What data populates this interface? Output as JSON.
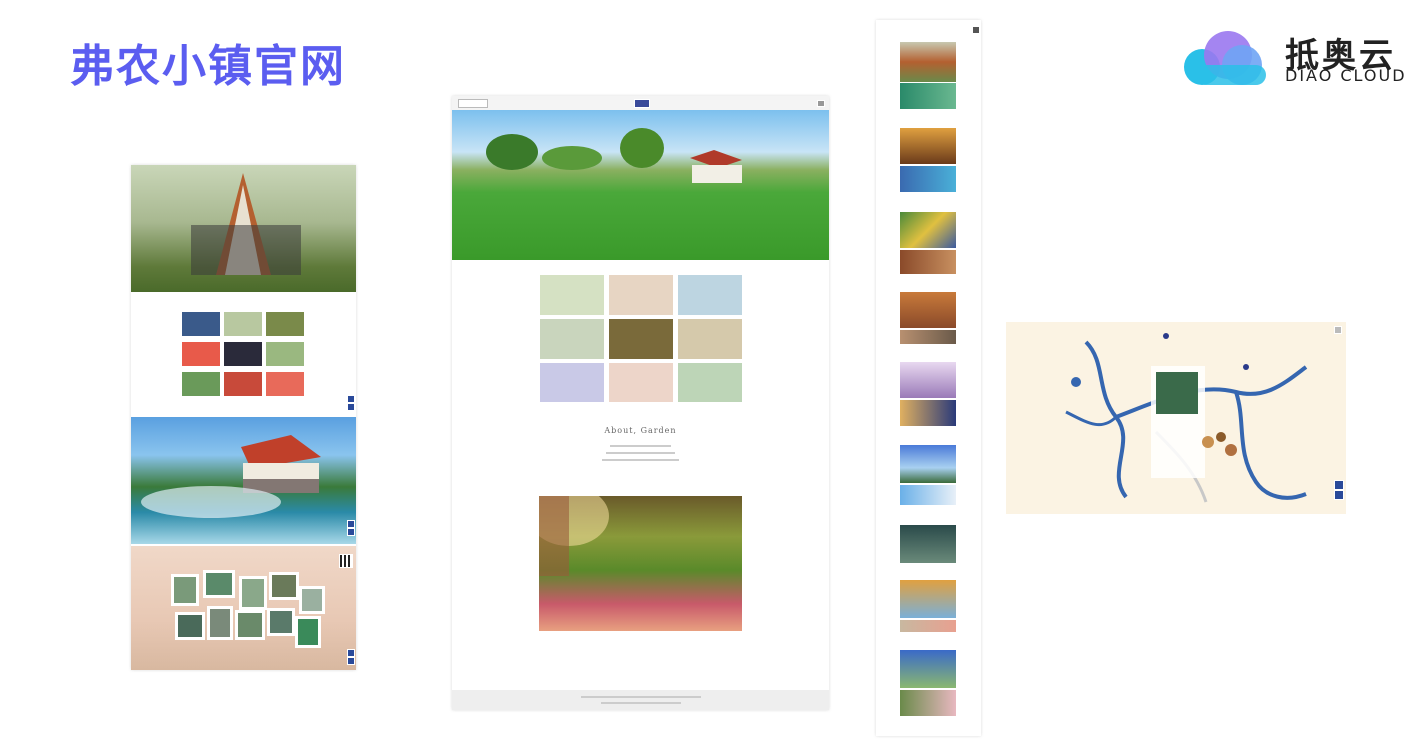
{
  "heading": "弗农小镇官网",
  "logo": {
    "name_cn": "抵奥云",
    "name_en": "DIAO CLOUD"
  },
  "mockup2": {
    "about_title": "About, Garden"
  },
  "colors": {
    "heading": "#5b5df0",
    "logo_blue": "#2ac0e8",
    "logo_purple": "#9a78f0",
    "map_bg": "#fbf3e3",
    "river": "#3566b0",
    "grass": "#4aa83a",
    "sky": "#7cc0ee"
  }
}
